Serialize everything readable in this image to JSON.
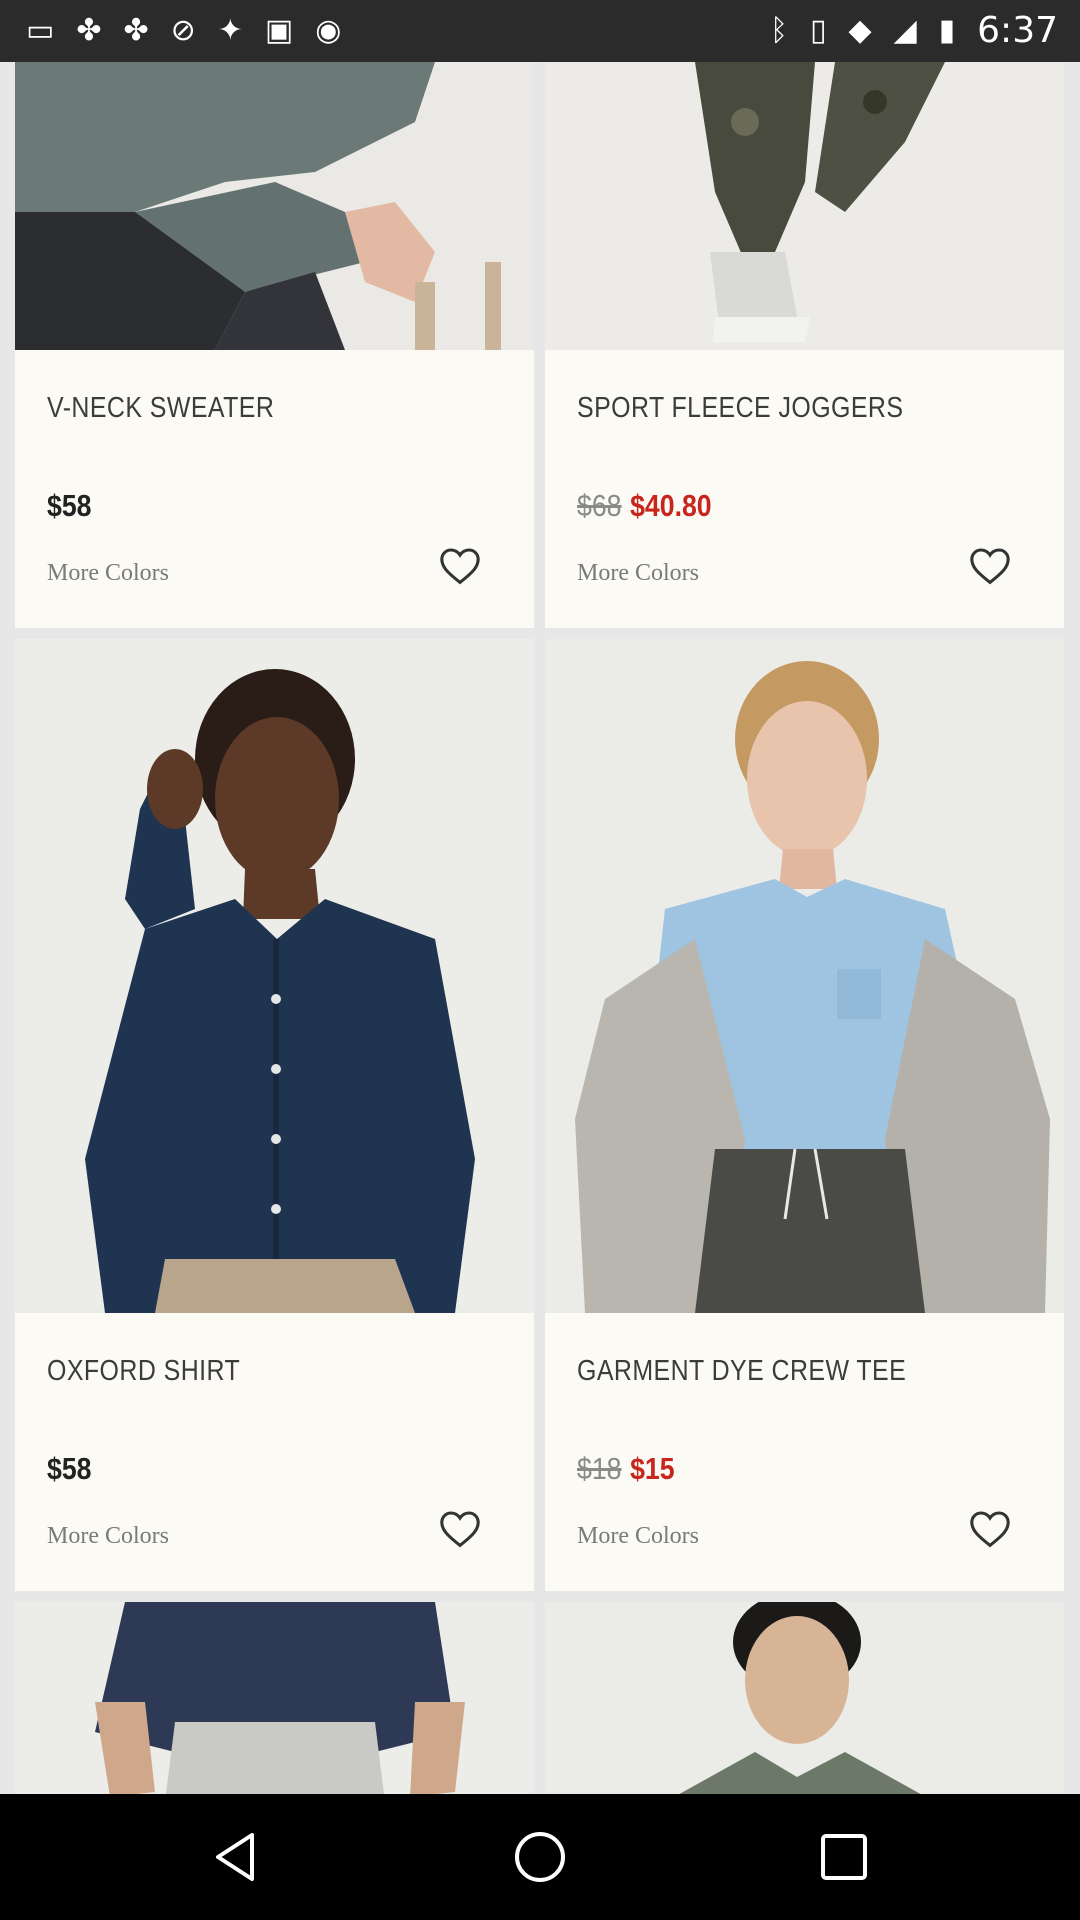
{
  "status_bar": {
    "left_icons": [
      "menu-icon",
      "fan-icon",
      "fan-icon",
      "blocked-icon",
      "fake-gps-icon",
      "lock-icon",
      "game-controller-icon"
    ],
    "right_icons": [
      "bluetooth-icon",
      "vibrate-icon",
      "wifi-icon",
      "signal-icon",
      "battery-icon"
    ],
    "time": "6:37"
  },
  "products": [
    {
      "name": "V-NECK SWEATER",
      "price": "$58",
      "more_colors": "More Colors",
      "image": "model-grey-sweater"
    },
    {
      "name": "SPORT FLEECE JOGGERS",
      "old_price": "$68",
      "sale_price": "$40.80",
      "more_colors": "More Colors",
      "image": "model-camo-joggers"
    },
    {
      "name": "OXFORD SHIRT",
      "price": "$58",
      "more_colors": "More Colors",
      "image": "model-navy-oxford-shirt"
    },
    {
      "name": "GARMENT DYE CREW TEE",
      "old_price": "$18",
      "sale_price": "$15",
      "more_colors": "More Colors",
      "image": "model-blue-tee"
    },
    {
      "image": "model-navy-longsleeve"
    },
    {
      "image": "model-green-hoodie"
    }
  ],
  "colors": {
    "sale": "#c8251c",
    "card_bg": "#fbfaf5",
    "page_bg": "#e7e7e7"
  },
  "nav": [
    "back-icon",
    "home-icon",
    "recents-icon"
  ]
}
